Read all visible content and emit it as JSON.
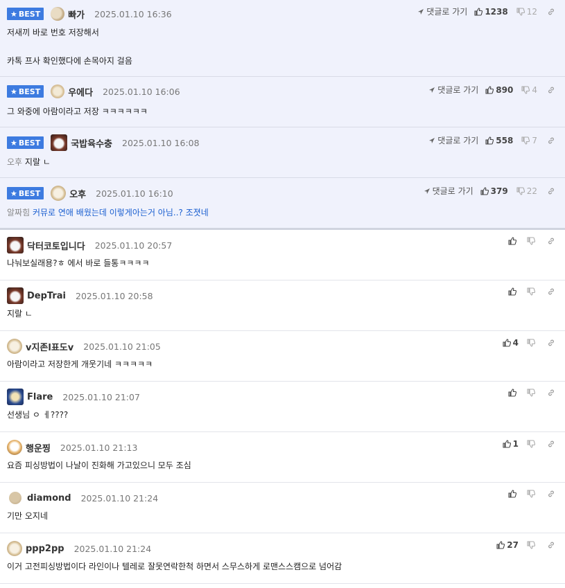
{
  "best_label": "BEST",
  "reply_label": "댓글로 가기",
  "best": [
    {
      "nick": "빠가",
      "date": "2025.01.10 16:36",
      "line1": "저새끼 바로 번호 저장해서",
      "line2": "카톡 프사 확인했다에 손목아지 걸음",
      "likes": "1238",
      "dislikes": "12"
    },
    {
      "nick": "우에다",
      "date": "2025.01.10 16:06",
      "line1": "그 와중에 아람이라고 저장 ㅋㅋㅋㅋㅋㅋ",
      "likes": "890",
      "dislikes": "4"
    },
    {
      "nick": "국밥육수충",
      "date": "2025.01.10 16:08",
      "reply": "오후",
      "line1": "지랄 ㄴ",
      "likes": "558",
      "dislikes": "7"
    },
    {
      "nick": "오후",
      "date": "2025.01.10 16:10",
      "reply": "알짜힘",
      "line1": "커뮤로 연애 배웠는데 이렇게아는거 아님..? 조졋네",
      "likes": "379",
      "dislikes": "22"
    }
  ],
  "comments": [
    {
      "nick": "닥터코토입니다",
      "date": "2025.01.10 20:57",
      "text": "나눠보실래용?ㅎ 에서 바로 들통ㅋㅋㅋㅋ",
      "likes": ""
    },
    {
      "nick": "DepTrai",
      "date": "2025.01.10 20:58",
      "text": "지랄 ㄴ",
      "likes": ""
    },
    {
      "nick": "v지존l표도v",
      "date": "2025.01.10 21:05",
      "text": "아람이라고 저장한게 개웃기네 ㅋㅋㅋㅋㅋ",
      "likes": "4"
    },
    {
      "nick": "Flare",
      "date": "2025.01.10 21:07",
      "text": "선생님 ㅇ ㅔ????",
      "likes": ""
    },
    {
      "nick": "행운찡",
      "date": "2025.01.10 21:13",
      "text": "요즘 피싱방법이 나날이 진화해 가고있으니 모두 조심",
      "likes": "1"
    },
    {
      "nick": "diamond",
      "date": "2025.01.10 21:24",
      "text": "기만 오지네",
      "likes": ""
    },
    {
      "nick": "ppp2pp",
      "date": "2025.01.10 21:24",
      "text": "이거 고전피싱방법이다 라인이나 텔레로 잘못연락한척 하면서 스무스하게 로맨스스캠으로 넘어감",
      "likes": "27"
    }
  ]
}
